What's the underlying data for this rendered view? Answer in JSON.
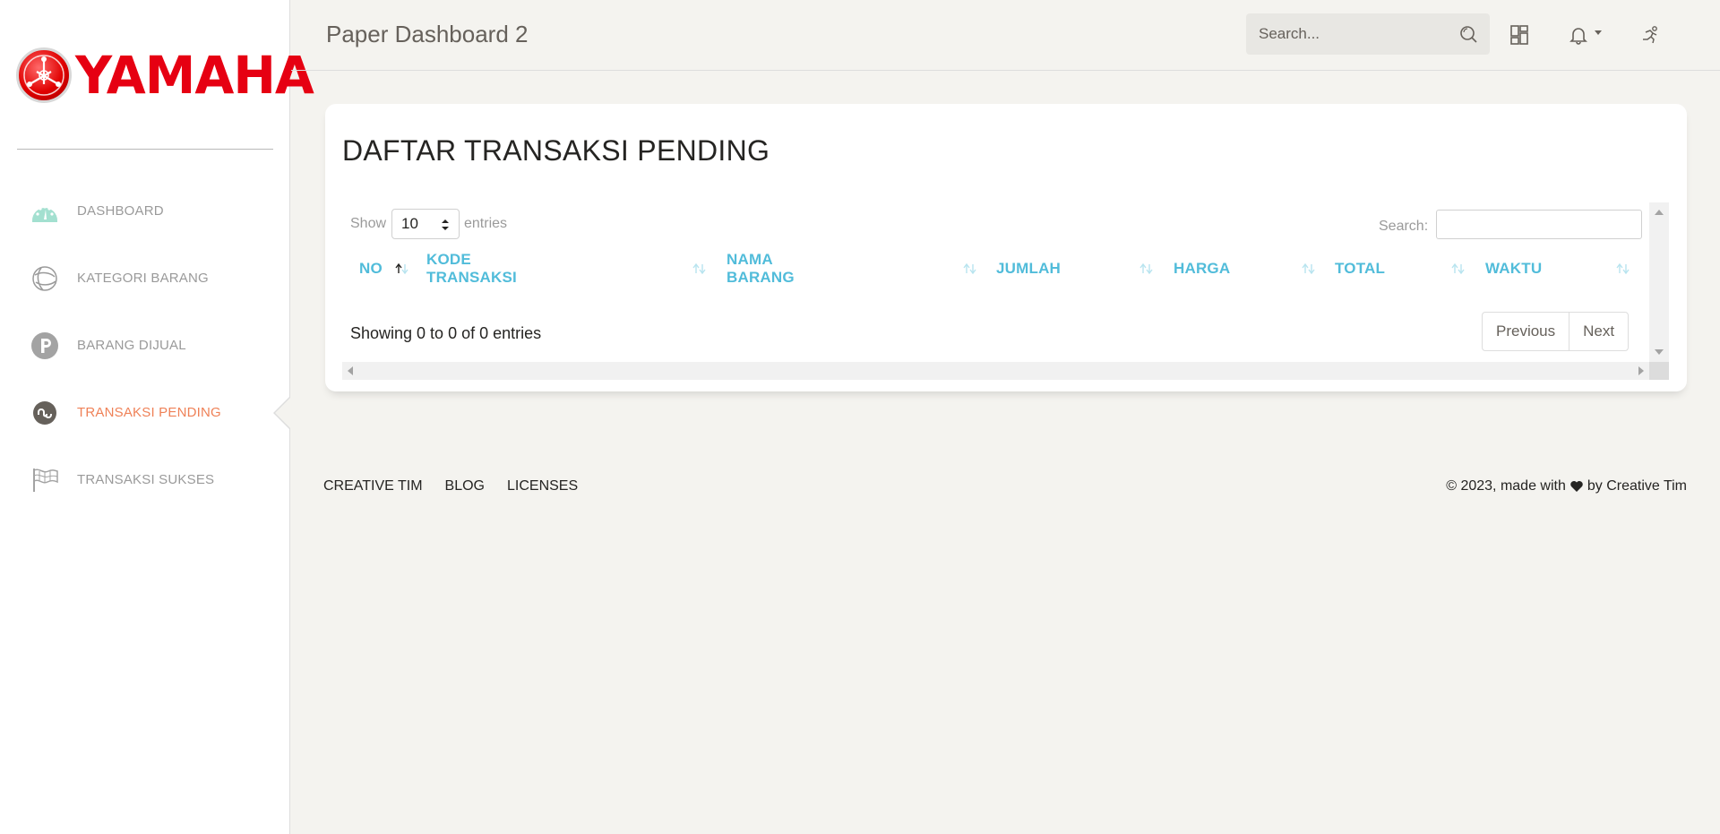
{
  "app": {
    "title": "Paper Dashboard 2",
    "accent_color": "#51bcda",
    "active_color": "#ef8157"
  },
  "logo": {
    "text": "YAMAHA",
    "color": "#e60012"
  },
  "sidebar": {
    "items": [
      {
        "label": "DASHBOARD",
        "icon": "speedometer-icon",
        "active": false
      },
      {
        "label": "KATEGORI BARANG",
        "icon": "globe-icon",
        "active": false
      },
      {
        "label": "BARANG DIJUAL",
        "icon": "parking-circle-icon",
        "active": false
      },
      {
        "label": "TRANSAKSI PENDING",
        "icon": "stumbleupon-icon",
        "active": true
      },
      {
        "label": "TRANSAKSI SUKSES",
        "icon": "flag-icon",
        "active": false
      }
    ]
  },
  "topbar": {
    "search_placeholder": "Search..."
  },
  "card": {
    "title": "DAFTAR TRANSAKSI PENDING",
    "show_label": "Show",
    "entries_value": "10",
    "entries_label": "entries",
    "search_label": "Search:",
    "columns": [
      "NO",
      "KODE TRANSAKSI",
      "NAMA BARANG",
      "JUMLAH",
      "HARGA",
      "TOTAL",
      "WAKTU"
    ],
    "info": "Showing 0 to 0 of 0 entries",
    "prev_label": "Previous",
    "next_label": "Next"
  },
  "footer": {
    "links": [
      "CREATIVE TIM",
      "BLOG",
      "LICENSES"
    ],
    "copyright_prefix": "© 2023, made with",
    "copyright_suffix": "by Creative Tim"
  }
}
